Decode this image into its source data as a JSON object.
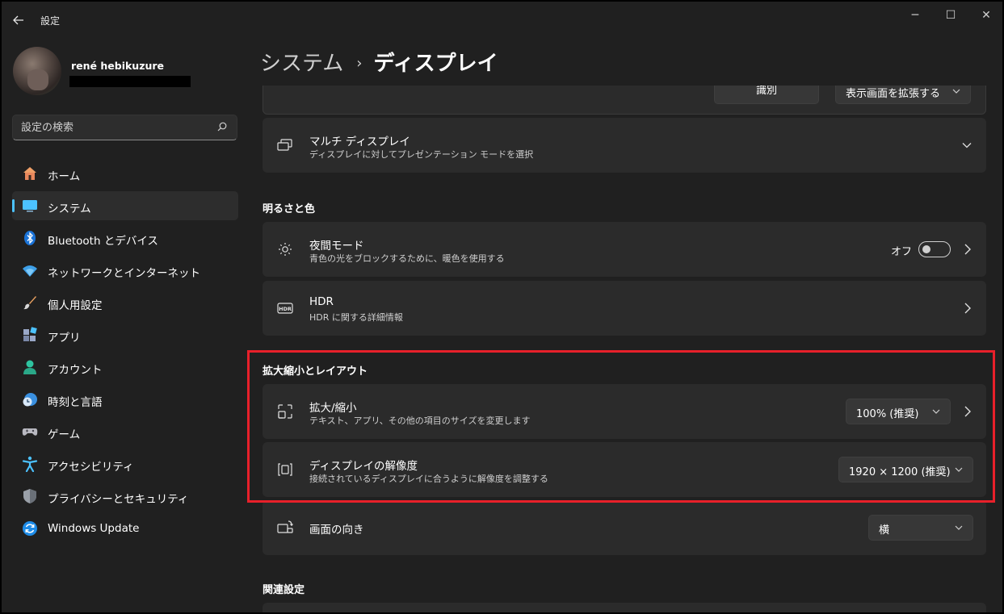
{
  "window": {
    "title": "設定",
    "back_icon": "back-arrow-icon",
    "controls": {
      "minimize": "─",
      "maximize": "☐",
      "close": "✕"
    }
  },
  "user": {
    "name": "rené hebikuzure"
  },
  "search": {
    "placeholder": "設定の検索"
  },
  "sidebar": {
    "items": [
      {
        "label": "ホーム",
        "icon": "home-icon"
      },
      {
        "label": "システム",
        "icon": "system-icon",
        "active": true
      },
      {
        "label": "Bluetooth とデバイス",
        "icon": "bluetooth-icon"
      },
      {
        "label": "ネットワークとインターネット",
        "icon": "wifi-icon"
      },
      {
        "label": "個人用設定",
        "icon": "brush-icon"
      },
      {
        "label": "アプリ",
        "icon": "apps-icon"
      },
      {
        "label": "アカウント",
        "icon": "account-icon"
      },
      {
        "label": "時刻と言語",
        "icon": "clock-globe-icon"
      },
      {
        "label": "ゲーム",
        "icon": "gamepad-icon"
      },
      {
        "label": "アクセシビリティ",
        "icon": "accessibility-icon"
      },
      {
        "label": "プライバシーとセキュリティ",
        "icon": "shield-icon"
      },
      {
        "label": "Windows Update",
        "icon": "update-icon"
      }
    ]
  },
  "breadcrumb": {
    "parent": "システム",
    "separator": "›",
    "current": "ディスプレイ"
  },
  "top_card": {
    "identify_label": "識別",
    "extend_label": "表示画面を拡張する"
  },
  "multi_display": {
    "title": "マルチ ディスプレイ",
    "subtitle": "ディスプレイに対してプレゼンテーション モードを選択"
  },
  "sections": {
    "brightness": "明るさと色",
    "scale_layout": "拡大縮小とレイアウト",
    "related": "関連設定"
  },
  "night_light": {
    "title": "夜間モード",
    "subtitle": "青色の光をブロックするために、暖色を使用する",
    "state_label": "オフ",
    "on": false
  },
  "hdr": {
    "title": "HDR",
    "subtitle": "HDR に関する詳細情報",
    "icon_text": "HDR"
  },
  "scale": {
    "title": "拡大/縮小",
    "subtitle": "テキスト、アプリ、その他の項目のサイズを変更します",
    "value": "100% (推奨)"
  },
  "resolution": {
    "title": "ディスプレイの解像度",
    "subtitle": "接続されているディスプレイに合うように解像度を調整する",
    "value": "1920 × 1200 (推奨)"
  },
  "orientation": {
    "title": "画面の向き",
    "value": "横"
  },
  "colors": {
    "accent": "#4cc2ff",
    "highlight": "#e8202a",
    "card": "#2b2b2b",
    "background": "#202020"
  }
}
